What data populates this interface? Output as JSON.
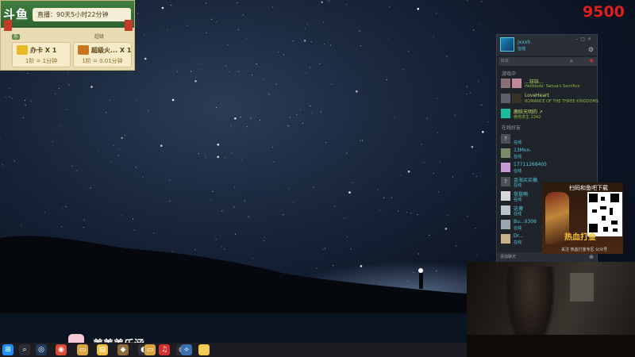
{
  "overlay": {
    "live_duration": "直播：90天5小时22分钟",
    "badge_a_label": "乐",
    "badge_b_label": "超级",
    "items": [
      {
        "name": "办卡 X 1",
        "rate": "1阶 = 1分钟",
        "icon": "card-icon",
        "color": "#e8b923"
      },
      {
        "name": "超级火... X 1",
        "rate": "1阶 = 0.01分钟",
        "icon": "rocket-icon",
        "color": "#c7761e"
      }
    ]
  },
  "score": "9500",
  "steam": {
    "me": {
      "name": "jxxxh",
      "status": "在线"
    },
    "search_placeholder": "好友",
    "ingame_header": "游戏中",
    "online_header": "在线好友",
    "ingame": [
      {
        "name": "...钰钰...",
        "status": "Hellblade: Senua's Sacrifice",
        "avatar": "pink-avatar"
      },
      {
        "name": "LoveHeart",
        "status": "ROMANCE OF THE THREE KINGDOMS",
        "avatar": "dark-avatar"
      },
      {
        "name": "鹿晗天明的 ↗",
        "status": "绝地求生 2342",
        "avatar": "green-avatar"
      }
    ],
    "online": [
      {
        "name": "?",
        "status": "在线"
      },
      {
        "name": "13Mon-",
        "status": "在线"
      },
      {
        "name": "17711268405",
        "status": "在线"
      },
      {
        "name": "金海买买搞",
        "status": "在线"
      },
      {
        "name": "挺挺啊",
        "status": "在线"
      },
      {
        "name": "这傻",
        "status": "在线"
      },
      {
        "name": "Bu...0306",
        "status": "在线"
      },
      {
        "name": "Dr...",
        "status": "在线"
      }
    ],
    "add_friend": "添加聊天"
  },
  "qr_ad": {
    "caption": "扫码和鱼吧下载",
    "game_title": "热血打金",
    "tagline": "关注 热血打金专区 公众号"
  },
  "streamer": {
    "name": "姜姜姜乐涵"
  },
  "taskbar": {
    "items": [
      {
        "icon": "windows-start-icon",
        "color": "#1e90ff",
        "glyph": "⊞"
      },
      {
        "icon": "search-icon",
        "color": "#2b2b33",
        "glyph": "⌕"
      },
      {
        "icon": "steam-icon",
        "color": "#223b5a",
        "glyph": "◎"
      },
      {
        "icon": "chrome-icon",
        "color": "#dd4b39",
        "glyph": "◉"
      },
      {
        "icon": "folder-icon",
        "color": "#d9a441",
        "glyph": "▭"
      },
      {
        "icon": "explorer-icon",
        "color": "#f0c040",
        "glyph": "▤"
      },
      {
        "icon": "app-icon",
        "color": "#8a6d3a",
        "glyph": "◆"
      },
      {
        "icon": "game-icon",
        "color": "#333",
        "glyph": "◐"
      },
      {
        "icon": "file-icon",
        "color": "#d9a441",
        "glyph": "▭"
      },
      {
        "icon": "netease-music-icon",
        "color": "#d32f2f",
        "glyph": "♫"
      },
      {
        "icon": "qq-icon",
        "color": "#2b2b33",
        "glyph": "◍"
      },
      {
        "icon": "network-icon",
        "color": "#3a6fb0",
        "glyph": "⟡"
      },
      {
        "icon": "chat-icon",
        "color": "#f2c94c",
        "glyph": "◌"
      }
    ]
  }
}
